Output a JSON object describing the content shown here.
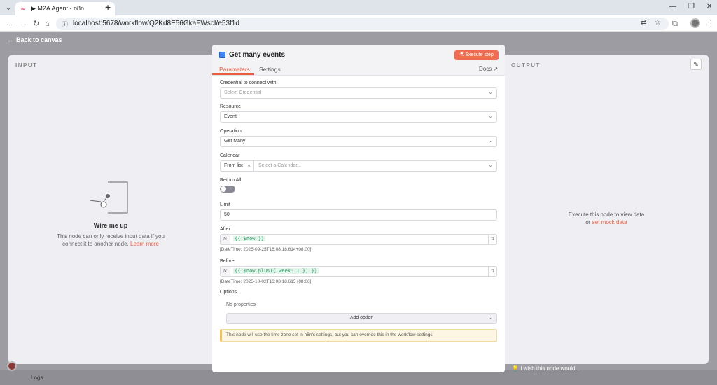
{
  "browser": {
    "tab_title": "▶ M2A Agent - n8n",
    "tab_close": "×",
    "new_tab": "+",
    "url": "localhost:5678/workflow/Q2Kd8E56GkaFWscI/e53f1d",
    "window_minimize": "—",
    "window_restore": "❐",
    "window_close": "✕"
  },
  "app": {
    "back_label": "Back to canvas",
    "input_label": "INPUT",
    "output_label": "OUTPUT",
    "wire_title": "Wire me up",
    "wire_desc": "This node can only receive input data if you connect it to another node.",
    "wire_link": "Learn more",
    "output_msg": "Execute this node to view data",
    "output_or": "or",
    "output_link": "set mock data",
    "logs_label": "Logs",
    "wish_text": "I wish this node would..."
  },
  "node": {
    "title": "Get many events",
    "execute_label": "Execute step",
    "tab_parameters": "Parameters",
    "tab_settings": "Settings",
    "docs_label": "Docs",
    "credential_label": "Credential to connect with",
    "credential_placeholder": "Select Credential",
    "resource_label": "Resource",
    "resource_value": "Event",
    "operation_label": "Operation",
    "operation_value": "Get Many",
    "calendar_label": "Calendar",
    "calendar_mode": "From list",
    "calendar_placeholder": "Select a Calendar...",
    "return_all_label": "Return All",
    "return_all": false,
    "limit_label": "Limit",
    "limit_value": "50",
    "after_label": "After",
    "after_expr": "{{ $now }}",
    "after_hint": "[DateTime: 2025-09-25T16:08:18.614+08:00]",
    "before_label": "Before",
    "before_expr": "{{ $now.plus({ week: 1 }) }}",
    "before_hint": "[DateTime: 2025-10-02T16:08:18.615+08:00]",
    "options_label": "Options",
    "no_properties": "No properties",
    "add_option_label": "Add option",
    "notice": "This node will use the time zone set in n8n's settings, but you can override this in the workflow settings"
  },
  "colors": {
    "accent": "#ea5e3f",
    "expression_green": "#2e9e6a"
  }
}
